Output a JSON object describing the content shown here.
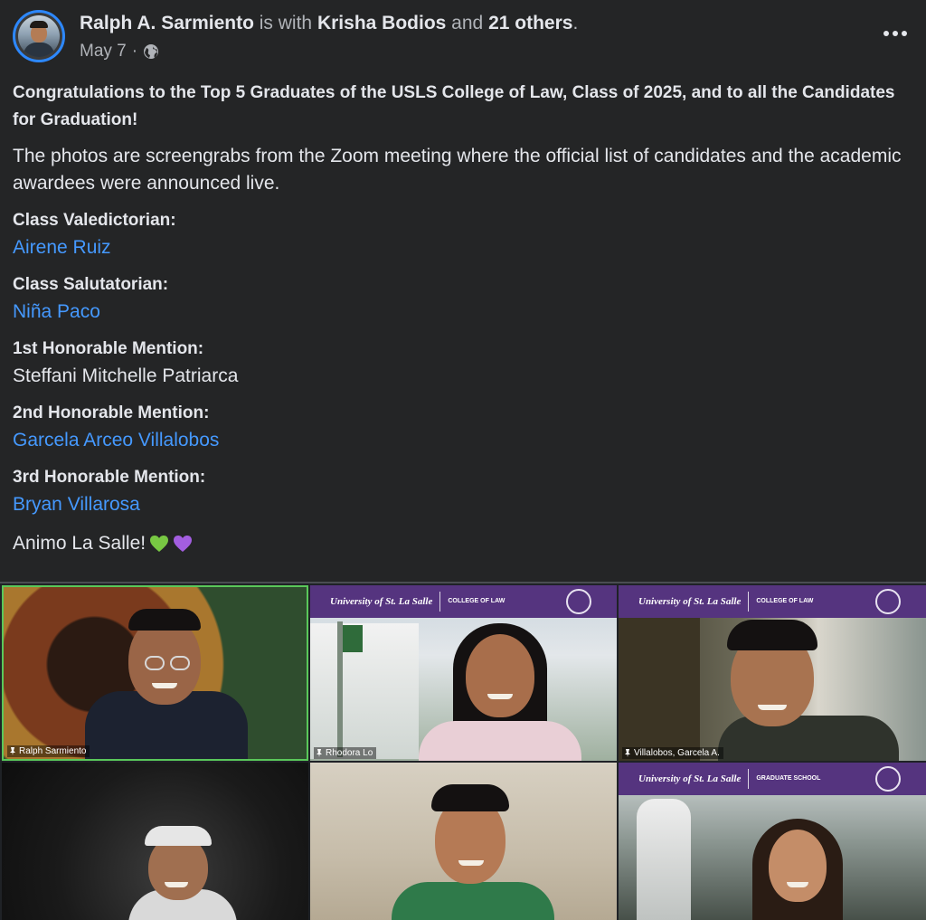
{
  "post": {
    "author": "Ralph A. Sarmiento",
    "with_text": "is with",
    "tagged": "Krisha Bodios",
    "and_text": "and",
    "others": "21 others",
    "period": ".",
    "date": "May 7",
    "separator": "·",
    "privacy_icon": "globe-icon",
    "more_icon": "ellipsis-icon",
    "headline": "Congratulations to the Top 5 Graduates of the USLS College of Law, Class of 2025, and to all the Candidates for Graduation!",
    "intro": "The photos are screengrabs from the Zoom meeting where the official list of candidates and the academic awardees were announced live.",
    "awards": [
      {
        "title": "Class Valedictorian:",
        "name": "Airene Ruiz",
        "linked": true
      },
      {
        "title": "Class Salutatorian:",
        "name": "Niña Paco",
        "linked": true
      },
      {
        "title": "1st Honorable Mention:",
        "name": "Steffani Mitchelle Patriarca",
        "linked": false
      },
      {
        "title": "2nd Honorable Mention:",
        "name": "Garcela Arceo Villalobos",
        "linked": true
      },
      {
        "title": "3rd Honorable Mention:",
        "name": "Bryan Villarosa",
        "linked": true
      }
    ],
    "closing": "Animo La Salle!",
    "closing_emojis": [
      "green-heart-icon",
      "purple-heart-icon"
    ]
  },
  "photo": {
    "tiles": [
      {
        "label": "Ralph Sarmiento"
      },
      {
        "label": "Rhodora Lo",
        "banner_logo": "University of St. La Salle",
        "banner_college": "COLLEGE OF LAW"
      },
      {
        "label": "Villalobos, Garcela A.",
        "banner_logo": "University of St. La Salle",
        "banner_college": "COLLEGE OF LAW"
      },
      {
        "label": ""
      },
      {
        "label": ""
      },
      {
        "label": "",
        "banner_logo": "University of St. La Salle",
        "banner_college": "GRADUATE SCHOOL"
      }
    ]
  },
  "colors": {
    "background": "#242526",
    "text": "#e4e6eb",
    "muted": "#b0b3b8",
    "link": "#4599ff",
    "banner": "#55347f"
  }
}
